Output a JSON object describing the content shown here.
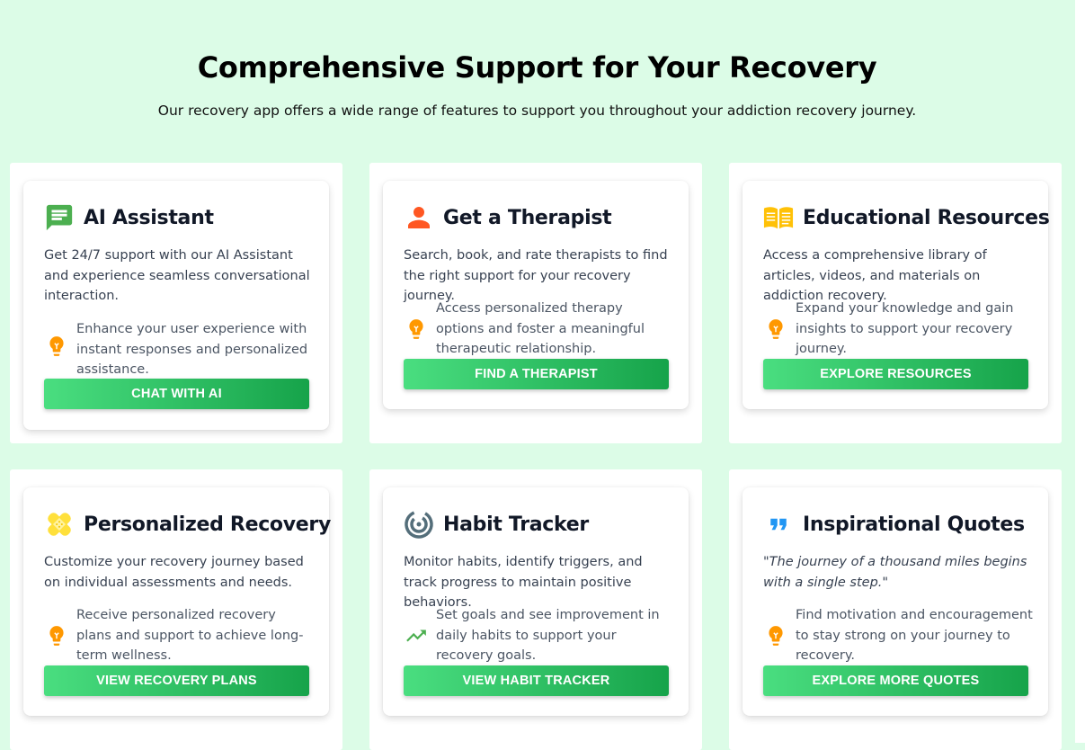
{
  "header": {
    "title": "Comprehensive Support for Your Recovery",
    "subtitle": "Our recovery app offers a wide range of features to support you throughout your addiction recovery journey."
  },
  "colors": {
    "background": "#dcfce7",
    "button_start": "#4ade80",
    "button_end": "#16a34a",
    "chat_icon": "#4caf50",
    "therapist_icon": "#ff5722",
    "book_icon": "#ffc107",
    "bulb_icon": "#ff9800",
    "habit_icon": "#546e7a",
    "trend_icon": "#4caf50",
    "quote_icon": "#2196f3"
  },
  "cards": [
    {
      "icon": "chat-message-icon",
      "title": "AI Assistant",
      "description": "Get 24/7 support with our AI Assistant and experience seamless conversational interaction.",
      "feature_icon": "lightbulb-icon",
      "feature": "Enhance your user experience with instant responses and personalized assistance.",
      "button": "CHAT WITH AI"
    },
    {
      "icon": "person-icon",
      "title": "Get a Therapist",
      "description": "Search, book, and rate therapists to find the right support for your recovery journey.",
      "feature_icon": "lightbulb-icon",
      "feature": "Access personalized therapy options and foster a meaningful therapeutic relationship.",
      "button": "FIND A THERAPIST"
    },
    {
      "icon": "open-book-icon",
      "title": "Educational Resources",
      "description": "Access a comprehensive library of articles, videos, and materials on addiction recovery.",
      "feature_icon": "lightbulb-icon",
      "feature": "Expand your knowledge and gain insights to support your recovery journey.",
      "button": "EXPLORE RESOURCES"
    },
    {
      "icon": "bandage-icon",
      "title": "Personalized Recovery",
      "description": "Customize your recovery journey based on individual assessments and needs.",
      "feature_icon": "lightbulb-icon",
      "feature": "Receive personalized recovery plans and support to achieve long-term wellness.",
      "button": "VIEW RECOVERY PLANS"
    },
    {
      "icon": "target-icon",
      "title": "Habit Tracker",
      "description": "Monitor habits, identify triggers, and track progress to maintain positive behaviors.",
      "feature_icon": "trending-up-icon",
      "feature": "Set goals and see improvement in daily habits to support your recovery goals.",
      "button": "VIEW HABIT TRACKER"
    },
    {
      "icon": "format-quote-icon",
      "title": "Inspirational Quotes",
      "description": "\"The journey of a thousand miles begins with a single step.\"",
      "feature_icon": "lightbulb-icon",
      "feature": "Find motivation and encouragement to stay strong on your journey to recovery.",
      "button": "EXPLORE MORE QUOTES"
    }
  ]
}
